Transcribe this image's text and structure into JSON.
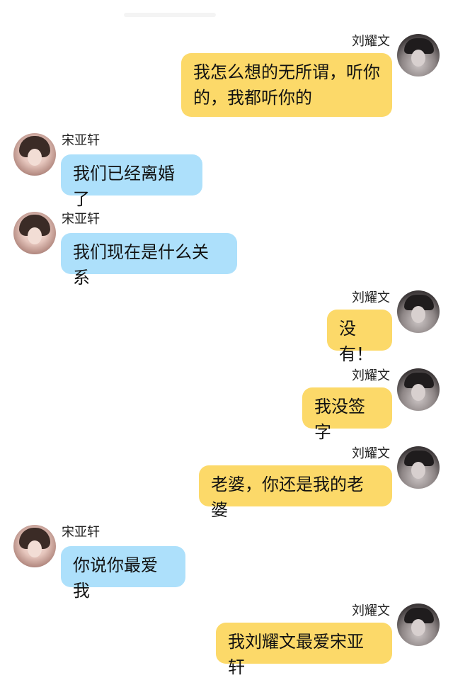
{
  "conversation": {
    "messages": [
      {
        "side": "right",
        "sender": "刘耀文",
        "text": "我怎么想的无所谓，听你的，我都听你的"
      },
      {
        "side": "left",
        "sender": "宋亚轩",
        "text": "我们已经离婚了"
      },
      {
        "side": "left",
        "sender": "宋亚轩",
        "text": "我们现在是什么关系"
      },
      {
        "side": "right",
        "sender": "刘耀文",
        "text": "没有！"
      },
      {
        "side": "right",
        "sender": "刘耀文",
        "text": "我没签字"
      },
      {
        "side": "right",
        "sender": "刘耀文",
        "text": "老婆，你还是我的老婆"
      },
      {
        "side": "left",
        "sender": "宋亚轩",
        "text": "你说你最爱我"
      },
      {
        "side": "right",
        "sender": "刘耀文",
        "text": "我刘耀文最爱宋亚轩"
      }
    ]
  },
  "colors": {
    "right_bubble": "#fcd969",
    "left_bubble": "#ade0fb",
    "background": "#ffffff"
  },
  "avatars": {
    "right": "male-cap-avatar",
    "left": "female-avatar"
  }
}
